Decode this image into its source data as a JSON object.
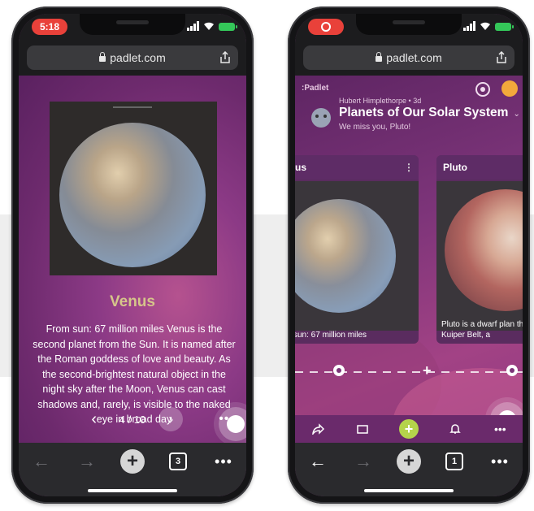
{
  "phones": {
    "left": {
      "status_time": "5:18",
      "url": "padlet.com",
      "post": {
        "title": "Venus",
        "body": "From sun: 67 million miles Venus is the second planet from the Sun. It is named after the Roman goddess of love and beauty. As the second-brightest natural object in the night sky after the Moon, Venus can cast shadows and, rarely, is visible to the naked eye in broad day"
      },
      "pager": {
        "prev_icon": "chevron-left-icon",
        "current": "4 / 10",
        "next_icon": "chevron-right-icon",
        "more": "•••"
      },
      "browser_nav": {
        "back": "←",
        "forward": "→",
        "new_tab": "+",
        "tabs_count": "3",
        "more": "•••"
      }
    },
    "right": {
      "url": "padlet.com",
      "board": {
        "logo": ":Padlet",
        "author": "Hubert Himplethorpe • 3d",
        "title": "Planets of Our Solar System",
        "subtitle": "We miss you, Pluto!"
      },
      "cards": [
        {
          "title": "us",
          "caption": "sun: 67 million miles"
        },
        {
          "title": "Pluto",
          "caption": "Pluto is a dwarf plan the Kuiper Belt, a"
        }
      ],
      "timeline": {
        "add": "+"
      },
      "toolbar": {
        "share_icon": "share-icon",
        "view_icon": "slideshow-icon",
        "add": "+",
        "bell_icon": "bell-icon",
        "more": "•••"
      },
      "browser_nav": {
        "back": "←",
        "forward": "→",
        "new_tab": "+",
        "tabs_count": "1",
        "more": "•••"
      }
    }
  },
  "colors": {
    "time_pill": "#e9413a",
    "venus_title": "#d6c58a",
    "add_button": "#b4d34b",
    "padlet_purple": "#6a2a6b"
  }
}
